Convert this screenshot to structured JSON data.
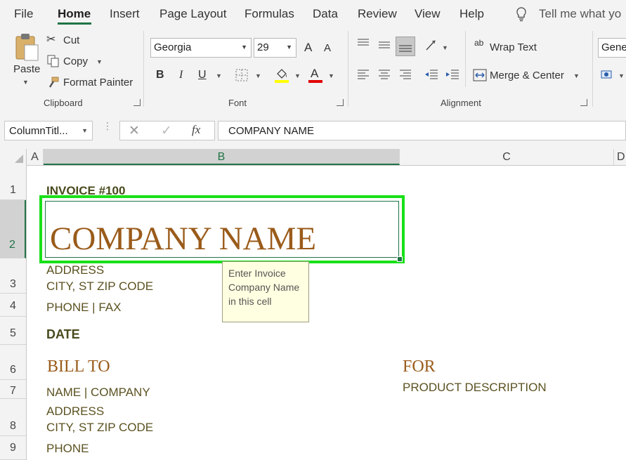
{
  "menu": {
    "file": "File",
    "home": "Home",
    "insert": "Insert",
    "page_layout": "Page Layout",
    "formulas": "Formulas",
    "data": "Data",
    "review": "Review",
    "view": "View",
    "help": "Help",
    "tell_me": "Tell me what yo"
  },
  "clipboard": {
    "paste": "Paste",
    "cut": "Cut",
    "copy": "Copy",
    "format_painter": "Format Painter",
    "label": "Clipboard"
  },
  "font": {
    "family": "Georgia",
    "size": "29",
    "grow": "A",
    "shrink": "A",
    "bold": "B",
    "italic": "I",
    "underline": "U",
    "font_color_glyph": "A",
    "label": "Font",
    "fill_color": "#ffff00",
    "text_color": "#e00000"
  },
  "alignment": {
    "wrap_text": "Wrap Text",
    "merge_center": "Merge & Center",
    "label": "Alignment",
    "wrap_icon": "ab"
  },
  "number": {
    "format": "Gener"
  },
  "formula_bar": {
    "name_box": "ColumnTitl...",
    "fx": "fx",
    "value": "COMPANY NAME"
  },
  "columns": [
    "A",
    "B",
    "C",
    "D"
  ],
  "rows": [
    "1",
    "2",
    "3",
    "4",
    "5",
    "6",
    "7",
    "8",
    "9"
  ],
  "cells": {
    "invoice": "INVOICE #100",
    "company_name": "COMPANY NAME",
    "address": "ADDRESS",
    "city": "CITY, ST ZIP CODE",
    "phone_fax": "PHONE | FAX",
    "date": "DATE",
    "bill_to": "BILL TO",
    "for": "FOR",
    "name_company": "NAME | COMPANY",
    "product_description": "PRODUCT DESCRIPTION",
    "address2": "ADDRESS",
    "city2": "CITY, ST ZIP CODE",
    "phone": "PHONE"
  },
  "tooltip": {
    "line1": "Enter Invoice",
    "line2": "Company Name",
    "line3": "in this cell"
  },
  "colors": {
    "accent": "#217346",
    "selection": "#18e018",
    "title_brown": "#9a5b1a",
    "text_olive": "#5b5221"
  }
}
